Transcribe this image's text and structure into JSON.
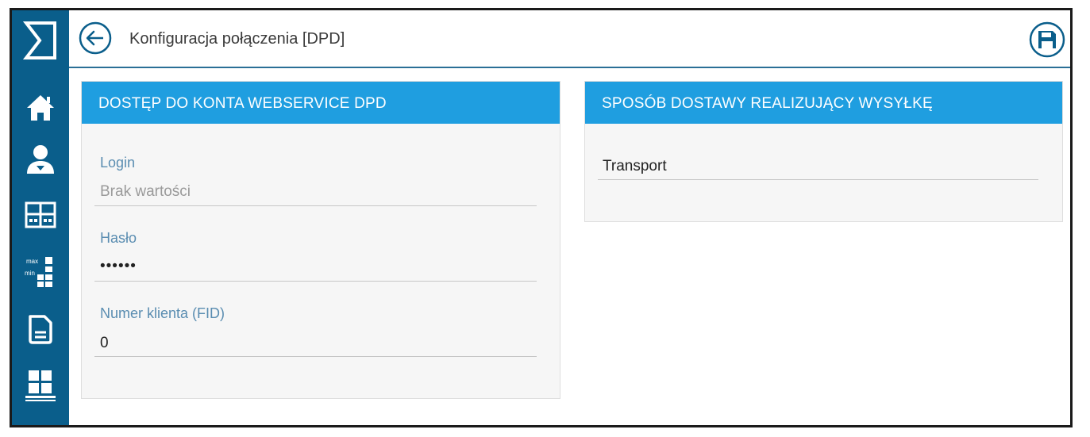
{
  "header": {
    "title": "Konfiguracja połączenia [DPD]",
    "back_icon": "arrow-left-circle-icon",
    "save_icon": "floppy-disk-icon"
  },
  "sidebar": {
    "logo_icon": "sigma-logo-icon",
    "items": [
      {
        "icon": "home-icon"
      },
      {
        "icon": "user-icon"
      },
      {
        "icon": "dashboard-grid-icon"
      },
      {
        "icon": "max-min-stock-icon",
        "max_label": "max",
        "min_label": "min"
      },
      {
        "icon": "document-icon"
      },
      {
        "icon": "warehouse-grid-icon"
      }
    ]
  },
  "left_panel": {
    "title": "DOSTĘP DO KONTA WEBSERVICE DPD",
    "fields": [
      {
        "label": "Login",
        "value": "",
        "placeholder": "Brak wartości"
      },
      {
        "label": "Hasło",
        "value": "••••••"
      },
      {
        "label": "Numer klienta (FID)",
        "value": "0"
      }
    ]
  },
  "right_panel": {
    "title": "SPOSÓB DOSTAWY REALIZUJĄCY WYSYŁKĘ",
    "value": "Transport"
  },
  "colors": {
    "sidebar": "#0a5e8b",
    "panel_header": "#1f9ee0",
    "label": "#5a8db1"
  }
}
